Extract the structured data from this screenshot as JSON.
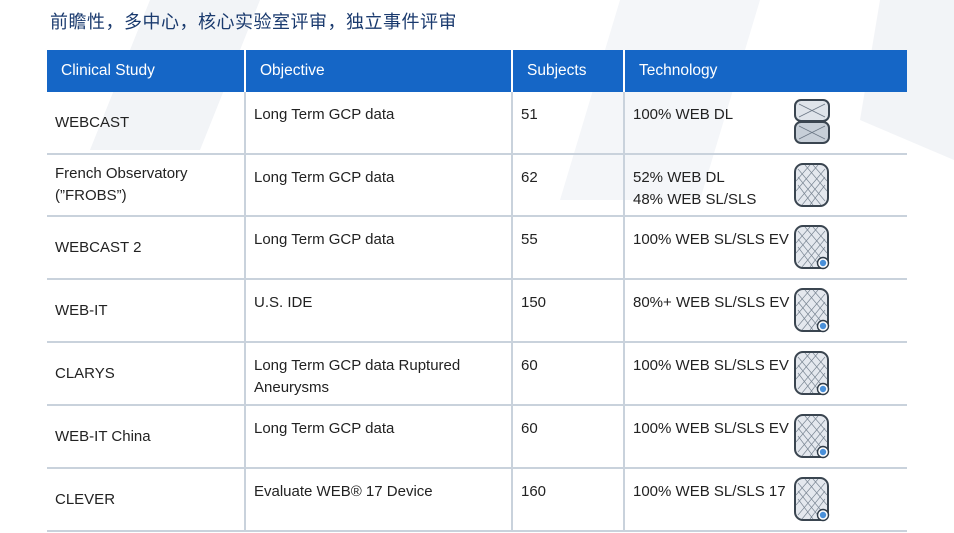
{
  "slide": {
    "title": "前瞻性，多中心，核心实验室评审，独立事件评审"
  },
  "table": {
    "headers": {
      "study": "Clinical Study",
      "objective": "Objective",
      "subjects": "Subjects",
      "technology": "Technology"
    },
    "rows": [
      {
        "study": "WEBCAST",
        "objective": "Long Term GCP data",
        "subjects": "51",
        "tech_line1": "100% WEB DL",
        "tech_line2": "",
        "device_icon": "web-dl-device-icon"
      },
      {
        "study": "French Observatory (”FROBS”)",
        "objective": "Long Term GCP data",
        "subjects": "62",
        "tech_line1": "52% WEB DL",
        "tech_line2": "48% WEB SL/SLS",
        "device_icon": "web-sl-device-icon"
      },
      {
        "study": "WEBCAST 2",
        "objective": "Long Term GCP data",
        "subjects": "55",
        "tech_line1": "100% WEB SL/SLS EV",
        "tech_line2": "",
        "device_icon": "web-sl-ev-device-icon"
      },
      {
        "study": "WEB-IT",
        "objective": "U.S. IDE",
        "subjects": "150",
        "tech_line1": "80%+ WEB SL/SLS EV",
        "tech_line2": "",
        "device_icon": "web-sl-ev-device-icon"
      },
      {
        "study": "CLARYS",
        "objective": "Long Term GCP data Ruptured Aneurysms",
        "subjects": "60",
        "tech_line1": "100% WEB SL/SLS EV",
        "tech_line2": "",
        "device_icon": "web-sl-ev-device-icon"
      },
      {
        "study": "WEB-IT China",
        "objective": "Long Term GCP data",
        "subjects": "60",
        "tech_line1": "100% WEB SL/SLS EV",
        "tech_line2": "",
        "device_icon": "web-sl-ev-device-icon"
      },
      {
        "study": "CLEVER",
        "objective": "Evaluate WEB® 17 Device",
        "subjects": "160",
        "tech_line1": "100% WEB SL/SLS 17",
        "tech_line2": "",
        "device_icon": "web-17-device-icon"
      }
    ]
  },
  "colors": {
    "header_bg": "#1566c6",
    "header_text": "#ffffff",
    "title_text": "#1a3a6e",
    "grid_line": "#c9d2dc",
    "device_marker": "#4a90d9"
  }
}
